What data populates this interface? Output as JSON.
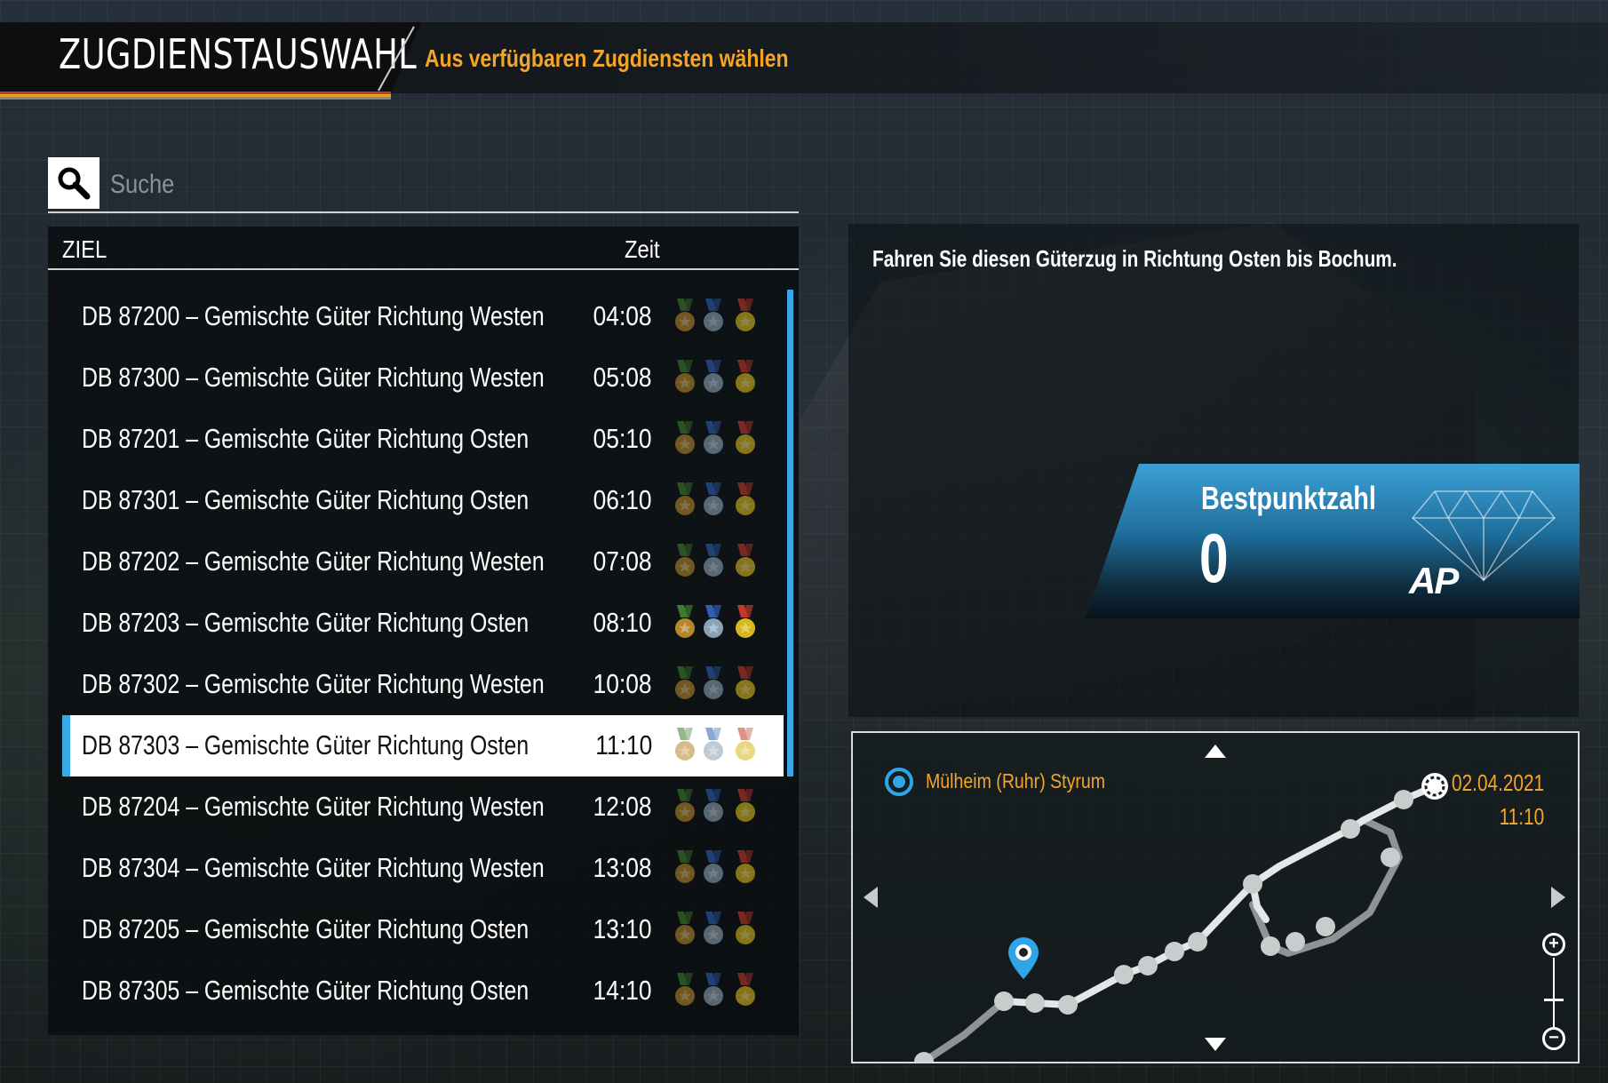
{
  "header": {
    "title": "ZUGDIENSTAUSWAHL",
    "subtitle": "Aus verfügbaren Zugdiensten wählen"
  },
  "search": {
    "placeholder": "Suche",
    "value": ""
  },
  "table": {
    "col_destination": "ZIEL",
    "col_time": "Zeit",
    "rows": [
      {
        "destination": "DB 87200 – Gemischte Güter Richtung Westen",
        "time": "04:08",
        "selected": false
      },
      {
        "destination": "DB 87300 – Gemischte Güter Richtung Westen",
        "time": "05:08",
        "selected": false
      },
      {
        "destination": "DB 87201 – Gemischte Güter Richtung Osten",
        "time": "05:10",
        "selected": false
      },
      {
        "destination": "DB 87301 – Gemischte Güter Richtung Osten",
        "time": "06:10",
        "selected": false
      },
      {
        "destination": "DB 87202 – Gemischte Güter Richtung Westen",
        "time": "07:08",
        "selected": false
      },
      {
        "destination": "DB 87203 – Gemischte Güter Richtung Osten",
        "time": "08:10",
        "selected": false
      },
      {
        "destination": "DB 87302 – Gemischte Güter Richtung Westen",
        "time": "10:08",
        "selected": false
      },
      {
        "destination": "DB 87303 – Gemischte Güter Richtung Osten",
        "time": "11:10",
        "selected": true
      },
      {
        "destination": "DB 87204 – Gemischte Güter Richtung Westen",
        "time": "12:08",
        "selected": false
      },
      {
        "destination": "DB 87304 – Gemischte Güter Richtung Westen",
        "time": "13:08",
        "selected": false
      },
      {
        "destination": "DB 87205 – Gemischte Güter Richtung Osten",
        "time": "13:10",
        "selected": false
      },
      {
        "destination": "DB 87305 – Gemischte Güter Richtung Osten",
        "time": "14:10",
        "selected": false
      }
    ],
    "medal_icons": [
      "bronze-medal-icon",
      "silver-medal-icon",
      "gold-medal-icon"
    ]
  },
  "details": {
    "description": "Fahren Sie diesen Güterzug in Richtung Osten bis Bochum.",
    "best_score_label": "Bestpunktzahl",
    "best_score_value": "0",
    "badge_icon": "diamond-icon",
    "badge_logo": "AP"
  },
  "map": {
    "location_name": "Mülheim (Ruhr) Styrum",
    "date": "02.04.2021",
    "time": "11:10",
    "icons": [
      "location-ring-icon",
      "map-pin-icon",
      "arrow-up-icon",
      "arrow-down-icon",
      "arrow-left-icon",
      "arrow-right-icon",
      "zoom-in-icon",
      "zoom-out-icon"
    ]
  },
  "colors": {
    "accent_orange": "#f3a52a",
    "accent_blue": "#38a9e6",
    "medal_bronze": "#b5862a",
    "medal_silver": "#8aa2b5",
    "medal_gold": "#d8b81c"
  }
}
